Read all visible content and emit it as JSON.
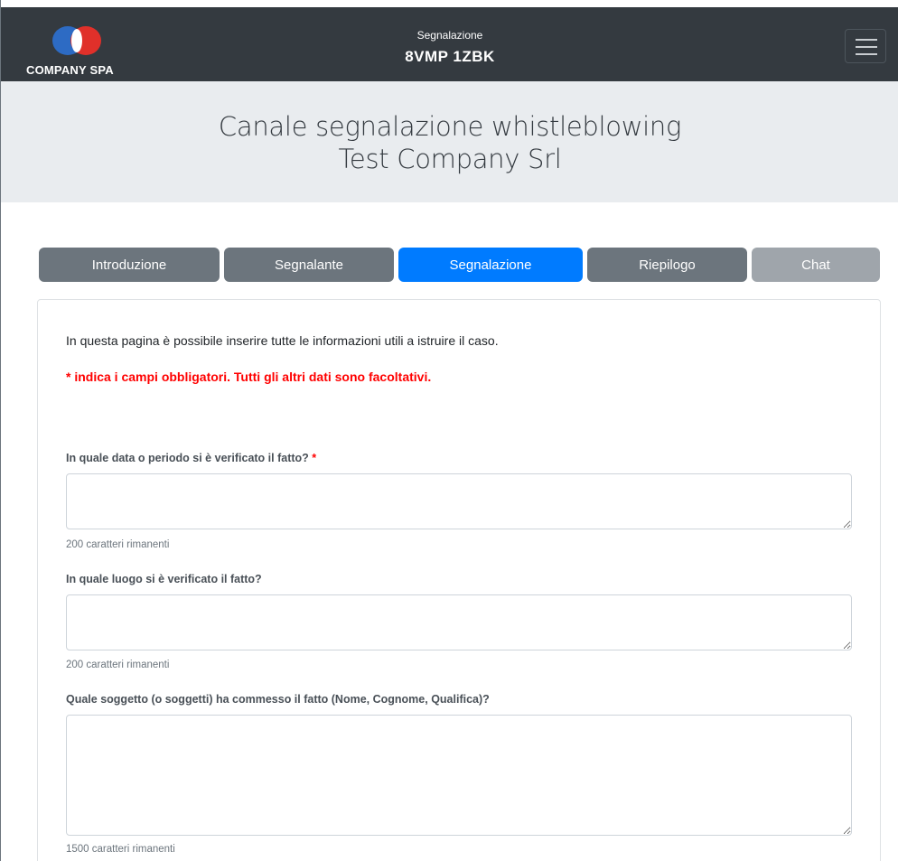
{
  "navbar": {
    "brand_text": "COMPANY SPA",
    "title_small": "Segnalazione",
    "code": "8VMP 1ZBK",
    "menu_icon": "hamburger-menu-icon"
  },
  "header": {
    "title": "Canale segnalazione whistleblowing",
    "company": "Test Company Srl"
  },
  "tabs": [
    {
      "label": "Introduzione",
      "state": "default"
    },
    {
      "label": "Segnalante",
      "state": "default"
    },
    {
      "label": "Segnalazione",
      "state": "active"
    },
    {
      "label": "Riepilogo",
      "state": "default"
    },
    {
      "label": "Chat",
      "state": "disabled"
    }
  ],
  "form": {
    "intro": "In questa pagina è possibile inserire tutte le informazioni utili a istruire il caso.",
    "required_note": "* indica i campi obbligatori. Tutti gli altri dati sono facoltativi.",
    "fields": [
      {
        "label": "In quale data o periodo si è verificato il fatto?",
        "required_marker": "*",
        "value": "",
        "counter": "200 caratteri rimanenti"
      },
      {
        "label": "In quale luogo si è verificato il fatto?",
        "value": "",
        "counter": "200 caratteri rimanenti"
      },
      {
        "label": "Quale soggetto (o soggetti) ha commesso il fatto (Nome, Cognome, Qualifica)?",
        "value": "",
        "counter": "1500 caratteri rimanenti"
      }
    ]
  },
  "colors": {
    "navbar_bg": "#343a40",
    "header_bg": "#e9ecef",
    "tab_default": "#6c757d",
    "tab_active": "#007bff",
    "tab_disabled": "#9fa5ab",
    "required": "#ff0000"
  }
}
